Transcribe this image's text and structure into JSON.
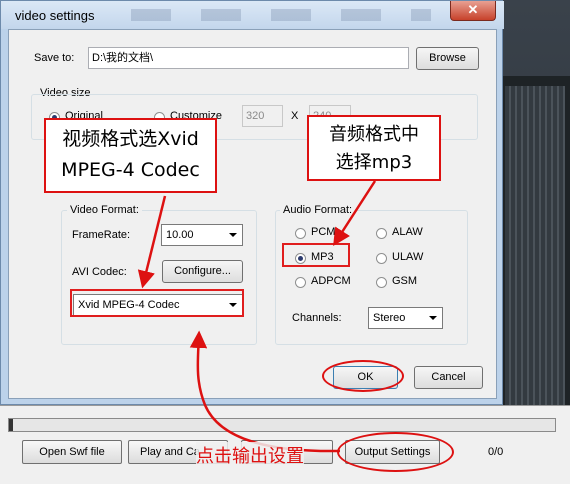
{
  "dialog": {
    "title": "video settings",
    "close_symbol": "✕",
    "save_to_label": "Save to:",
    "save_to_value": "D:\\我的文档\\",
    "browse_label": "Browse",
    "video_size": {
      "group_label": "Video size",
      "original_label": "Original",
      "customize_label": "Customize",
      "width_value": "320",
      "x_label": "X",
      "height_value": "240"
    },
    "video_format": {
      "group_label": "Video Format:",
      "framerate_label": "FrameRate:",
      "framerate_value": "10.00",
      "codec_label": "AVI Codec:",
      "configure_label": "Configure...",
      "codec_value": "Xvid MPEG-4 Codec"
    },
    "audio_format": {
      "group_label": "Audio Format:",
      "options": [
        "PCM",
        "ALAW",
        "MP3",
        "ULAW",
        "ADPCM",
        "GSM"
      ],
      "selected": "MP3",
      "channels_label": "Channels:",
      "channels_value": "Stereo"
    },
    "ok_label": "OK",
    "cancel_label": "Cancel"
  },
  "background": {
    "open_swf_label": "Open Swf file",
    "play_label": "Play and Ca",
    "output_settings_label": "Output Settings",
    "counter": "0/0"
  },
  "annotations": {
    "video_note_line1": "视频格式选Xvid",
    "video_note_line2": "MPEG-4 Codec",
    "audio_note_line1": "音频格式中",
    "audio_note_line2": "选择mp3",
    "output_note": "点击输出设置"
  },
  "colors": {
    "annotation_red": "#dd1111",
    "titlebar": "#c3d6ec"
  }
}
